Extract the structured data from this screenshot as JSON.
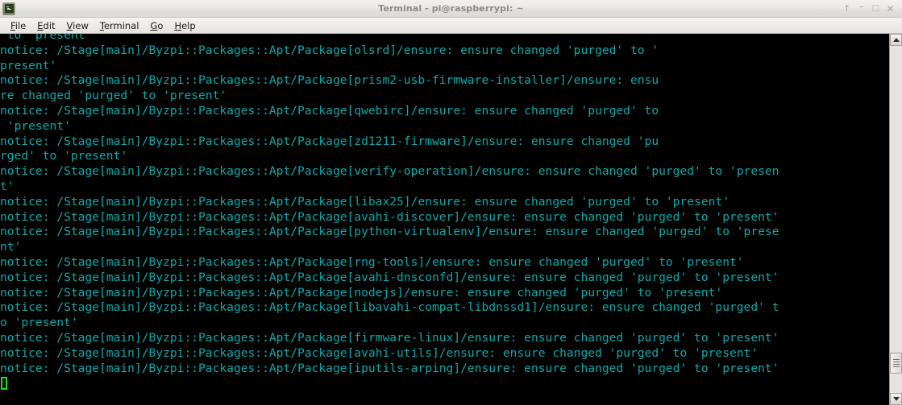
{
  "window": {
    "title": "Terminal - pi@raspberrypi: ~",
    "icon": "terminal-icon",
    "controls": {
      "shade": "↑",
      "minimize": "–",
      "maximize": "□",
      "close": "✕"
    }
  },
  "menubar": {
    "items": [
      {
        "accel": "F",
        "rest": "ile"
      },
      {
        "accel": "E",
        "rest": "dit"
      },
      {
        "accel": "V",
        "rest": "iew"
      },
      {
        "accel": "T",
        "rest": "erminal"
      },
      {
        "accel": "G",
        "rest": "o"
      },
      {
        "accel": "H",
        "rest": "elp"
      }
    ]
  },
  "terminal": {
    "foreground_color": "#11a8a8",
    "background_color": "#000000",
    "cursor_color": "#19e219",
    "lines": [
      " to 'present'",
      "notice: /Stage[main]/Byzpi::Packages::Apt/Package[olsrd]/ensure: ensure changed 'purged' to '",
      "present'",
      "notice: /Stage[main]/Byzpi::Packages::Apt/Package[prism2-usb-firmware-installer]/ensure: ensu",
      "re changed 'purged' to 'present'",
      "notice: /Stage[main]/Byzpi::Packages::Apt/Package[qwebirc]/ensure: ensure changed 'purged' to",
      " 'present'",
      "notice: /Stage[main]/Byzpi::Packages::Apt/Package[zd1211-firmware]/ensure: ensure changed 'pu",
      "rged' to 'present'",
      "notice: /Stage[main]/Byzpi::Packages::Apt/Package[verify-operation]/ensure: ensure changed 'purged' to 'presen",
      "t'",
      "notice: /Stage[main]/Byzpi::Packages::Apt/Package[libax25]/ensure: ensure changed 'purged' to 'present'",
      "notice: /Stage[main]/Byzpi::Packages::Apt/Package[avahi-discover]/ensure: ensure changed 'purged' to 'present'",
      "notice: /Stage[main]/Byzpi::Packages::Apt/Package[python-virtualenv]/ensure: ensure changed 'purged' to 'prese",
      "nt'",
      "notice: /Stage[main]/Byzpi::Packages::Apt/Package[rng-tools]/ensure: ensure changed 'purged' to 'present'",
      "notice: /Stage[main]/Byzpi::Packages::Apt/Package[avahi-dnsconfd]/ensure: ensure changed 'purged' to 'present'",
      "notice: /Stage[main]/Byzpi::Packages::Apt/Package[nodejs]/ensure: ensure changed 'purged' to 'present'",
      "notice: /Stage[main]/Byzpi::Packages::Apt/Package[libavahi-compat-libdnssd1]/ensure: ensure changed 'purged' t",
      "o 'present'",
      "notice: /Stage[main]/Byzpi::Packages::Apt/Package[firmware-linux]/ensure: ensure changed 'purged' to 'present'",
      "notice: /Stage[main]/Byzpi::Packages::Apt/Package[avahi-utils]/ensure: ensure changed 'purged' to 'present'",
      "notice: /Stage[main]/Byzpi::Packages::Apt/Package[iputils-arping]/ensure: ensure changed 'purged' to 'present'"
    ]
  },
  "scrollbar": {
    "up_arrow": "scroll-up-arrow",
    "down_arrow": "scroll-down-arrow",
    "thumb_position_percent": 94
  }
}
